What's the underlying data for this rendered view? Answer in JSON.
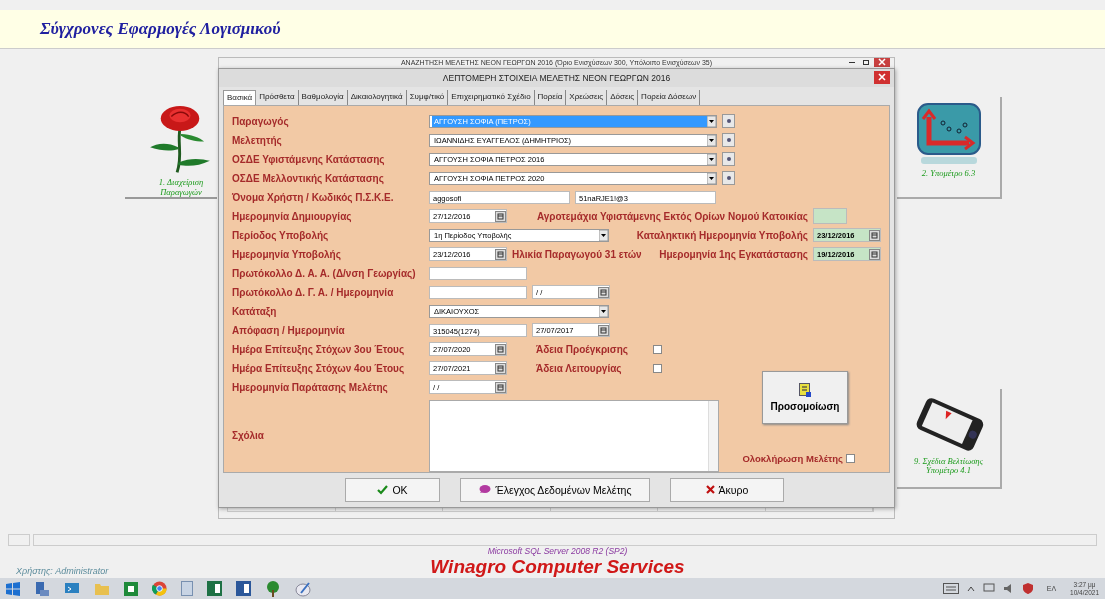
{
  "header": {
    "title": "Σύγχρονες Εφαρμογές Λογισμικού"
  },
  "tiles": [
    {
      "kind": "rose",
      "caption": "1. Διαχείριση Παραγωγών"
    },
    {
      "kind": "chart",
      "caption": "2. Υπομέτρο 6.3"
    },
    {
      "kind": "phone",
      "caption": "9. Σχέδια Βελτίωσης Υπομέτρο 4.1"
    }
  ],
  "parent_window": {
    "title": "ΑΝΑΖΗΤΗΣΗ ΜΕΛΕΤΗΣ ΝΕΟΝ ΓΕΩΡΓΩΝ 2016 (Όριο Ενισχύσεων 300, Υπόλοιπο Ενισχύσεων 35)"
  },
  "dialog": {
    "title": "ΛΕΠΤΟΜΕΡΗ ΣΤΟΙΧΕΙΑ ΜΕΛΕΤΗΣ ΝΕΟΝ ΓΕΩΡΓΩΝ 2016",
    "tabs": [
      {
        "label": "Βασικά",
        "selected": true
      },
      {
        "label": "Πρόσθετα",
        "selected": false
      },
      {
        "label": "Βαθμολογία",
        "selected": false
      },
      {
        "label": "Δικαιολογητικά",
        "selected": false
      },
      {
        "label": "Συμφ/τικό",
        "selected": false
      },
      {
        "label": "Επιχειρηματικό Σχέδιο",
        "selected": false
      },
      {
        "label": "Πορεία",
        "selected": false
      },
      {
        "label": "Χρεώσεις",
        "selected": false
      },
      {
        "label": "Δόσεις",
        "selected": false
      },
      {
        "label": "Πορεία Δόσεων",
        "selected": false
      }
    ],
    "rows": [
      {
        "label": "Παραγωγός",
        "fields": [
          {
            "kind": "long_combo",
            "value": "ΑΓΓΟΥΣΗ ΣΟΦΙΑ (ΠΕΤΡΟΣ)",
            "highlighted": true
          },
          {
            "kind": "add_button"
          }
        ]
      },
      {
        "label": "Μελετητής",
        "fields": [
          {
            "kind": "long_combo",
            "value": "ΙΩΑΝΝΙΔΗΣ ΕΥΑΓΓΕΛΟΣ (ΔΗΜΗΤΡΙΟΣ)",
            "highlighted": false
          },
          {
            "kind": "add_button"
          }
        ]
      },
      {
        "label": "ΟΣΔΕ Υφιστάμενης Κατάστασης",
        "fields": [
          {
            "kind": "long_combo",
            "value": "ΑΓΓΟΥΣΗ ΣΟΦΙΑ ΠΕΤΡΟΣ 2016",
            "highlighted": false
          },
          {
            "kind": "add_button"
          }
        ]
      },
      {
        "label": "ΟΣΔΕ Μελλοντικής Κατάστασης",
        "fields": [
          {
            "kind": "long_combo",
            "value": "ΑΓΓΟΥΣΗ ΣΟΦΙΑ ΠΕΤΡΟΣ 2020",
            "highlighted": false
          },
          {
            "kind": "add_button"
          }
        ]
      },
      {
        "label": "Όνομα Χρήστη / Κωδικός Π.Σ.Κ.Ε.",
        "fields": [
          {
            "kind": "wide_text",
            "value": "aggosofi"
          },
          {
            "kind": "wide_text",
            "value": "51naRJE1!@3"
          }
        ]
      },
      {
        "label": "Ημερομηνία Δημιουργίας",
        "fields": [
          {
            "kind": "date",
            "value": "27/12/2016"
          },
          {
            "kind": "side_label",
            "text": "Αγροτεμάχια Υφιστάμενης Εκτός Ορίων Νομού Κατοικίας"
          },
          {
            "kind": "green_box"
          }
        ]
      },
      {
        "label": "Περίοδος Υποβολής",
        "fields": [
          {
            "kind": "combo",
            "value": "1η Περίοδος Υποβολής",
            "highlighted": false
          },
          {
            "kind": "side_label",
            "text": "Καταληκτική Ημερομηνία Υποβολής"
          },
          {
            "kind": "green_date",
            "value": "23/12/2016"
          }
        ]
      },
      {
        "label": "Ημερομηνία Υποβολής",
        "fields": [
          {
            "kind": "date",
            "value": "23/12/2016"
          },
          {
            "kind": "note",
            "text": "Ηλικία Παραγωγού 31 ετών"
          },
          {
            "kind": "side_label",
            "text": "Ημερομηνία 1ης Εγκατάστασης"
          },
          {
            "kind": "green_date",
            "value": "19/12/2016"
          }
        ]
      },
      {
        "label": "Πρωτόκολλο Δ. Α. Α. (Δ/νση Γεωργίας)",
        "fields": [
          {
            "kind": "text"
          }
        ]
      },
      {
        "label": "Πρωτόκολλο Δ. Γ. Α. / Ημερομηνία",
        "fields": [
          {
            "kind": "text"
          },
          {
            "kind": "date",
            "value": "/ /"
          }
        ]
      },
      {
        "label": "Κατάταξη",
        "fields": [
          {
            "kind": "combo",
            "value": "ΔΙΚΑΙΟΥΧΟΣ",
            "highlighted": false
          }
        ]
      },
      {
        "label": "Απόφαση / Ημερομηνία",
        "fields": [
          {
            "kind": "text",
            "value": "315045(1274)"
          },
          {
            "kind": "date",
            "value": "27/07/2017"
          }
        ]
      },
      {
        "label": "Ημέρα Επίτευξης Στόχων 3ου Έτους",
        "fields": [
          {
            "kind": "date",
            "value": "27/07/2020"
          },
          {
            "kind": "check_label",
            "text": "Άδεια Προέγκρισης"
          },
          {
            "kind": "checkbox",
            "checked": false
          }
        ]
      },
      {
        "label": "Ημέρα Επίτευξης Στόχων 4ου Έτους",
        "fields": [
          {
            "kind": "date",
            "value": "27/07/2021"
          },
          {
            "kind": "check_label",
            "text": "Άδεια Λειτουργίας"
          },
          {
            "kind": "checkbox",
            "checked": false
          }
        ]
      },
      {
        "label": "Ημερομηνία Παράτασης Μελέτης",
        "fields": [
          {
            "kind": "date",
            "value": "/ /"
          }
        ]
      }
    ],
    "comments": {
      "label": "Σχόλια"
    },
    "simulate_button": {
      "label": "Προσομοίωση"
    },
    "completion": {
      "label": "Ολοκλήρωση Μελέτης",
      "checked": false
    },
    "buttons": [
      {
        "kind": "ok",
        "label": "OK"
      },
      {
        "kind": "check",
        "label": "Έλεγχος Δεδομένων Μελέτης"
      },
      {
        "kind": "cancel",
        "label": "Άκυρο"
      }
    ]
  },
  "footer": {
    "user": "Χρήστης: Administrator",
    "server": "Microsoft SQL Server 2008 R2 (SP2)",
    "company": "Winagro Computer Services"
  },
  "taskbar": {
    "language": "ΕΛ",
    "time": "3:27 μμ",
    "date": "10/4/2021"
  }
}
